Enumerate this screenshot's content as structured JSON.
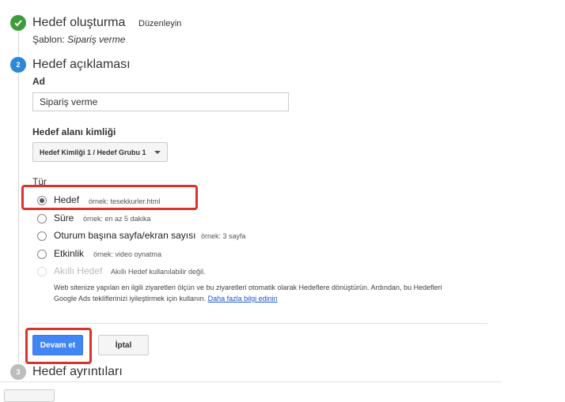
{
  "step1": {
    "title": "Hedef oluşturma",
    "edit_label": "Düzenleyin",
    "template_prefix": "Şablon:",
    "template_value": "Sipariş verme"
  },
  "step2": {
    "number": "2",
    "title": "Hedef açıklaması",
    "name_label": "Ad",
    "name_value": "Sipariş verme",
    "slot_label": "Hedef alanı kimliği",
    "slot_value": "Hedef Kimliği 1 / Hedef Grubu 1",
    "type_label": "Tür",
    "types": [
      {
        "label": "Hedef",
        "example": "örnek: tesekkurler.html"
      },
      {
        "label": "Süre",
        "example": "örnek: en az 5 dakika"
      },
      {
        "label": "Oturum başına sayfa/ekran sayısı",
        "example": "örnek: 3 sayfa"
      },
      {
        "label": "Etkinlik",
        "example": "örnek: video oynatma"
      },
      {
        "label": "Akıllı Hedef",
        "example": "Akıllı Hedef kullanılabilir değil."
      }
    ],
    "smart_info_line1": "Web sitenize yapılan en ilgili ziyaretleri ölçün ve bu ziyaretleri otomatik olarak Hedeflere dönüştürün. Ardından, bu Hedefleri",
    "smart_info_line2": "Google Ads tekliflerinizi iyileştirmek için kullanın.",
    "learn_more": "Daha fazla bilgi edinin",
    "continue_label": "Devam et",
    "cancel_label": "İptal"
  },
  "step3": {
    "number": "3",
    "title": "Hedef ayrıntıları"
  },
  "colors": {
    "success_green": "#3c9c3c",
    "step_blue": "#2d88d6",
    "step_gray": "#bdbdbd",
    "primary_button": "#4285f4",
    "highlight_red": "#d9332b",
    "link_blue": "#1a55cc"
  }
}
